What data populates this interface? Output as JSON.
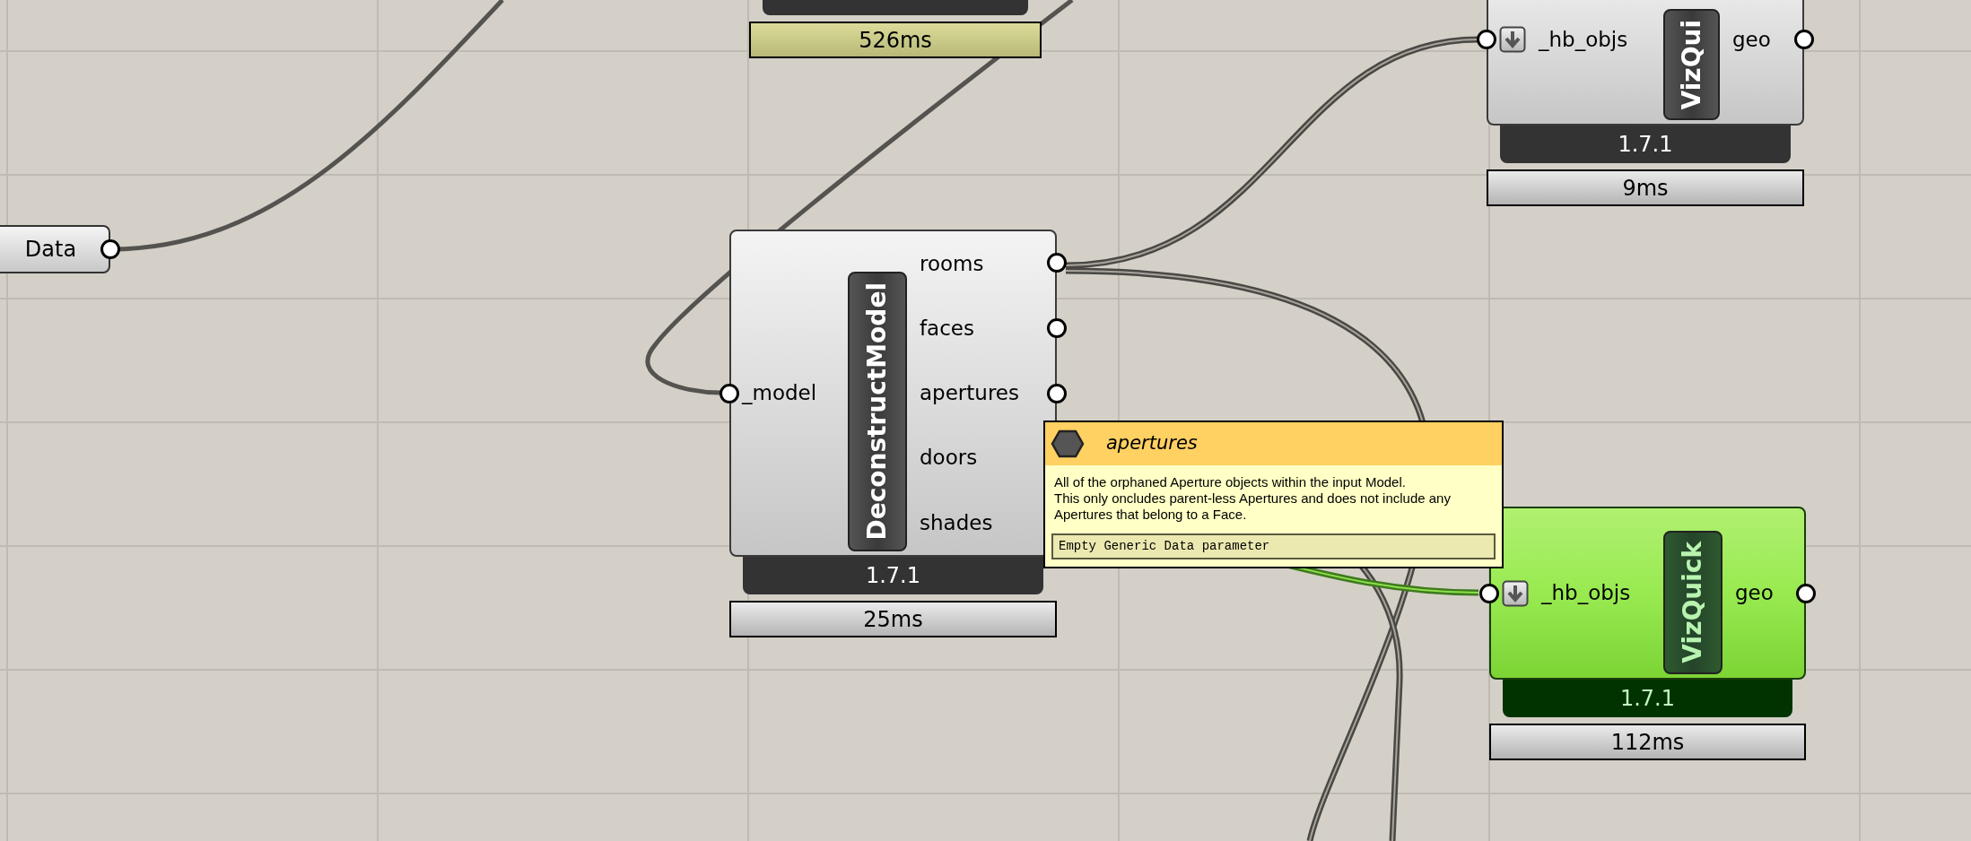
{
  "data_param": {
    "label": "Data"
  },
  "components": [
    {
      "kind": "stub",
      "timing": "526ms",
      "slow": true
    },
    {
      "kind": "component",
      "title": "VizQui",
      "selected": false,
      "inputs": [
        {
          "name": "_hb_objs",
          "flatten": true
        }
      ],
      "outputs": [
        {
          "name": "geo"
        }
      ],
      "version": "1.7.1",
      "timing": "9ms",
      "slow": false
    },
    {
      "kind": "component",
      "title": "DeconstructModel",
      "selected": false,
      "inputs": [
        {
          "name": "_model",
          "flatten": false
        }
      ],
      "outputs": [
        {
          "name": "rooms"
        },
        {
          "name": "faces"
        },
        {
          "name": "apertures"
        },
        {
          "name": "doors"
        },
        {
          "name": "shades"
        }
      ],
      "version": "1.7.1",
      "timing": "25ms",
      "slow": false
    },
    {
      "kind": "component",
      "title": "VizQuick",
      "selected": true,
      "inputs": [
        {
          "name": "_hb_objs",
          "flatten": true
        }
      ],
      "outputs": [
        {
          "name": "geo"
        }
      ],
      "version": "1.7.1",
      "timing": "112ms",
      "slow": false
    }
  ],
  "tooltip": {
    "title": "apertures",
    "description_lines": [
      "All of the orphaned Aperture objects within the input Model.",
      "This only oncludes parent-less Apertures and does not include any",
      "Apertures that belong to a Face."
    ],
    "status": "Empty Generic Data parameter"
  }
}
